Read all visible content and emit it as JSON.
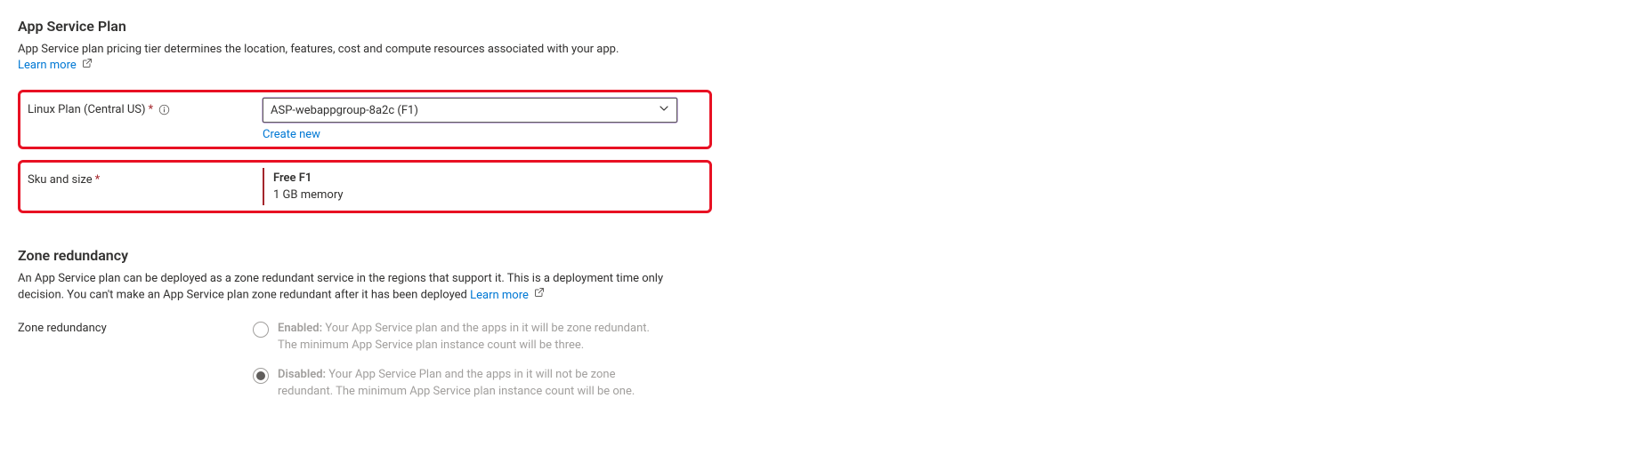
{
  "appServicePlan": {
    "title": "App Service Plan",
    "description": "App Service plan pricing tier determines the location, features, cost and compute resources associated with your app.",
    "learnMore": "Learn more",
    "planLabel": "Linux Plan (Central US)",
    "planSelected": "ASP-webappgroup-8a2c (F1)",
    "createNew": "Create new",
    "skuLabel": "Sku and size",
    "skuName": "Free F1",
    "skuDesc": "1 GB memory"
  },
  "zoneRedundancy": {
    "title": "Zone redundancy",
    "description": "An App Service plan can be deployed as a zone redundant service in the regions that support it. This is a deployment time only decision. You can't make an App Service plan zone redundant after it has been deployed",
    "learnMore": "Learn more",
    "fieldLabel": "Zone redundancy",
    "options": {
      "enabled": {
        "label": "Enabled:",
        "text": " Your App Service plan and the apps in it will be zone redundant. The minimum App Service plan instance count will be three."
      },
      "disabled": {
        "label": "Disabled:",
        "text": " Your App Service Plan and the apps in it will not be zone redundant. The minimum App Service plan instance count will be one."
      }
    }
  }
}
